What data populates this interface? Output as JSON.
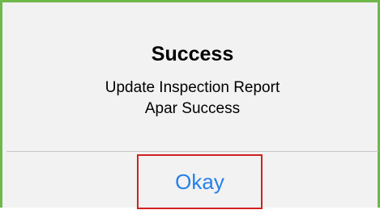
{
  "alert": {
    "title": "Success",
    "message_line1": "Update Inspection Report",
    "message_line2": "Apar Success",
    "button_label": "Okay"
  },
  "colors": {
    "frame_border": "#6fb84b",
    "highlight_border": "#d32020",
    "button_text": "#2680eb",
    "dialog_background": "#f2f2f2"
  }
}
